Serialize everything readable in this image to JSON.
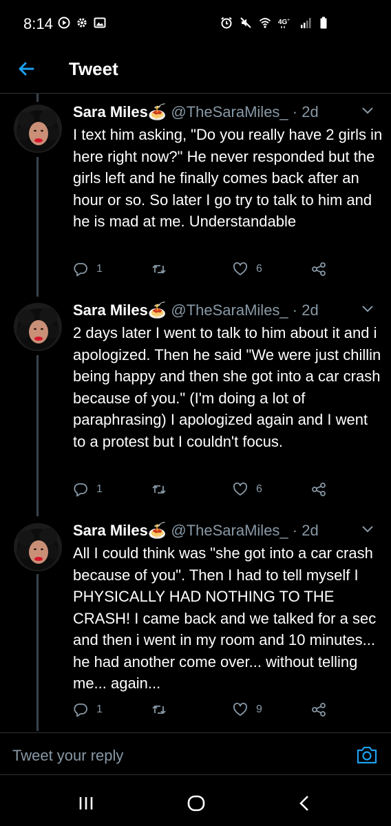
{
  "status_bar": {
    "time": "8:14",
    "left_icons": [
      "record-icon",
      "gear-icon",
      "gallery-icon"
    ],
    "right_icons": [
      "alarm-icon",
      "mute-icon",
      "wifi-icon",
      "4g-icon",
      "signal-icon",
      "battery-icon"
    ]
  },
  "header": {
    "title": "Tweet",
    "back_icon": "arrow-left-icon",
    "accent": "#1da1f2"
  },
  "tweets": [
    {
      "name": "Sara Miles",
      "name_emoji": "🍝",
      "handle": "@TheSaraMiles_",
      "separator": " · ",
      "time": "2d",
      "text": "I text him asking, \"Do you really have 2 girls in here right now?\" He never responded but the girls left and he finally comes back after an hour or so. So later I go try to talk to him and he is mad at me. Understandable",
      "replies": "1",
      "retweets": "",
      "likes": "6"
    },
    {
      "name": "Sara Miles",
      "name_emoji": "🍝",
      "handle": "@TheSaraMiles_",
      "separator": " · ",
      "time": "2d",
      "text": "2 days later I went to talk to him about it and i apologized. Then he said \"We were just chillin being happy and then she got into a car crash because of you.\" (I'm doing a lot of paraphrasing) I apologized again and I went to a protest but I couldn't focus.",
      "replies": "1",
      "retweets": "",
      "likes": "6"
    },
    {
      "name": "Sara Miles",
      "name_emoji": "🍝",
      "handle": "@TheSaraMiles_",
      "separator": " · ",
      "time": "2d",
      "text": "All I could think was \"she got into a car crash because of you\". Then I had to tell myself I PHYSICALLY HAD NOTHING TO THE CRASH! I came back and we talked for a sec and then i went in my room and 10 minutes... he had another come over... without telling me... again...",
      "replies": "1",
      "retweets": "",
      "likes": "9"
    }
  ],
  "reply_bar": {
    "placeholder": "Tweet your reply",
    "camera_icon": "camera-icon"
  },
  "nav_bar": {
    "icons": [
      "recents-icon",
      "home-icon",
      "back-icon"
    ]
  },
  "colors": {
    "background": "#000000",
    "text": "#ffffff",
    "muted": "#8899a6",
    "accent": "#1da1f2",
    "divider": "#2f3336",
    "thread_line": "#38444d"
  }
}
